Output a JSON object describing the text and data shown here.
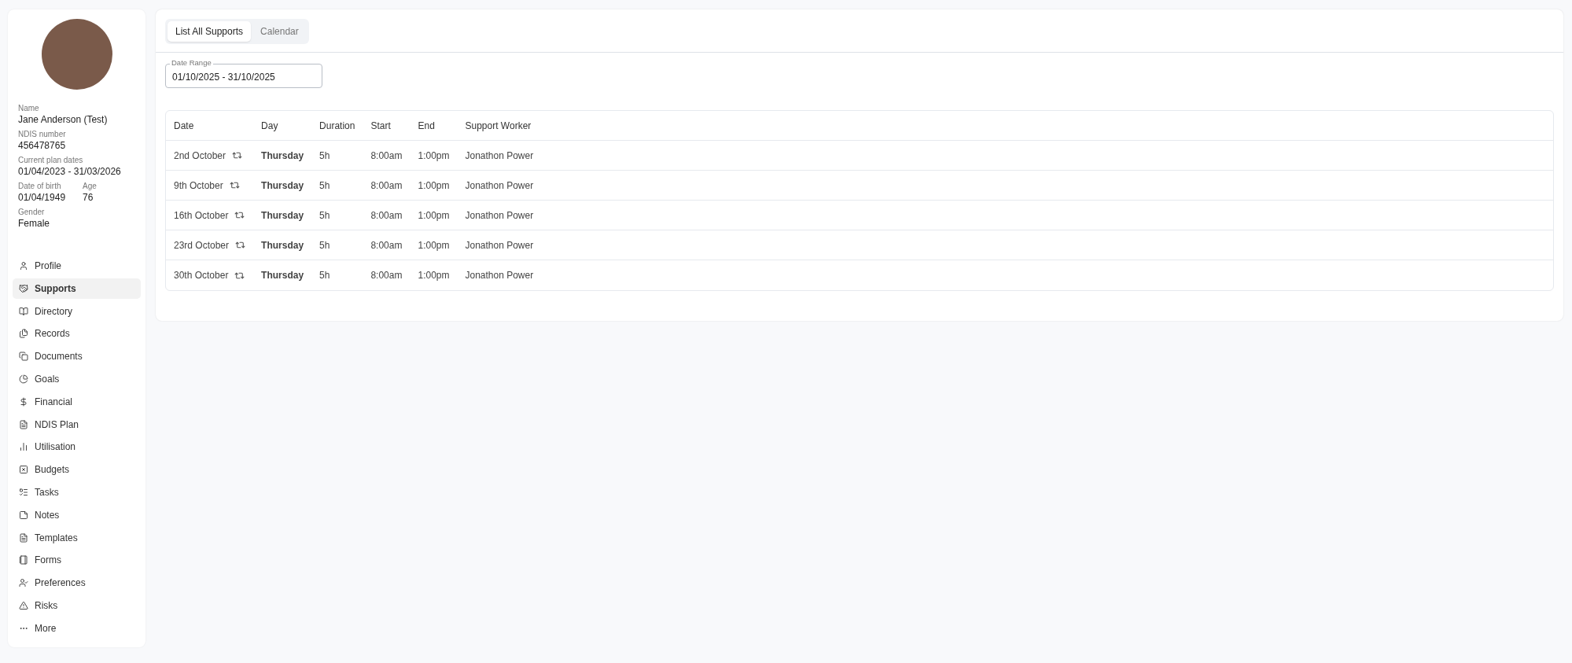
{
  "profile": {
    "fields": [
      {
        "label": "Name",
        "value": "Jane Anderson (Test)"
      },
      {
        "label": "NDIS number",
        "value": "456478765"
      },
      {
        "label": "Current plan dates",
        "value": "01/04/2023 - 31/03/2026"
      }
    ],
    "pair": [
      {
        "label": "Date of birth",
        "value": "01/04/1949"
      },
      {
        "label": "Age",
        "value": "76"
      }
    ],
    "last": {
      "label": "Gender",
      "value": "Female"
    }
  },
  "sidebar": {
    "items": [
      {
        "label": "Profile",
        "selected": false
      },
      {
        "label": "Supports",
        "selected": true
      },
      {
        "label": "Directory",
        "selected": false
      },
      {
        "label": "Records",
        "selected": false
      },
      {
        "label": "Documents",
        "selected": false
      },
      {
        "label": "Goals",
        "selected": false
      },
      {
        "label": "Financial",
        "selected": false
      },
      {
        "label": "NDIS Plan",
        "selected": false
      },
      {
        "label": "Utilisation",
        "selected": false
      },
      {
        "label": "Budgets",
        "selected": false
      },
      {
        "label": "Tasks",
        "selected": false
      },
      {
        "label": "Notes",
        "selected": false
      },
      {
        "label": "Templates",
        "selected": false
      },
      {
        "label": "Forms",
        "selected": false
      },
      {
        "label": "Preferences",
        "selected": false
      },
      {
        "label": "Risks",
        "selected": false
      },
      {
        "label": "More",
        "selected": false
      }
    ]
  },
  "tabs": [
    {
      "label": "List All Supports",
      "selected": true
    },
    {
      "label": "Calendar",
      "selected": false
    }
  ],
  "date_range": {
    "label": "Date Range",
    "value": "01/10/2025 - 31/10/2025"
  },
  "table": {
    "columns": [
      "Date",
      "Day",
      "Duration",
      "Start",
      "End",
      "Support Worker"
    ],
    "rows": [
      {
        "date": "2nd October",
        "day": "Thursday",
        "duration": "5h",
        "start": "8:00am",
        "end": "1:00pm",
        "worker": "Jonathon Power"
      },
      {
        "date": "9th October",
        "day": "Thursday",
        "duration": "5h",
        "start": "8:00am",
        "end": "1:00pm",
        "worker": "Jonathon Power"
      },
      {
        "date": "16th October",
        "day": "Thursday",
        "duration": "5h",
        "start": "8:00am",
        "end": "1:00pm",
        "worker": "Jonathon Power"
      },
      {
        "date": "23rd October",
        "day": "Thursday",
        "duration": "5h",
        "start": "8:00am",
        "end": "1:00pm",
        "worker": "Jonathon Power"
      },
      {
        "date": "30th October",
        "day": "Thursday",
        "duration": "5h",
        "start": "8:00am",
        "end": "1:00pm",
        "worker": "Jonathon Power"
      }
    ]
  }
}
